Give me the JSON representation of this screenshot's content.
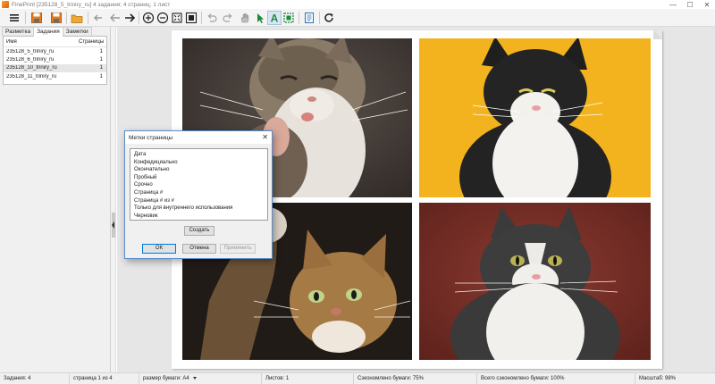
{
  "window": {
    "title": "FinePrint [235128_5_triniry_ru] 4 задания; 4 страниц; 1 лист",
    "minimize": "—",
    "maximize": "☐",
    "close": "✕"
  },
  "toolbar": {
    "buttons": [
      {
        "name": "menu-icon"
      },
      {
        "name": "save-icon"
      },
      {
        "name": "open-folder-icon"
      },
      {
        "name": "back-arrow-icon"
      },
      {
        "name": "forward-arrow-icon"
      },
      {
        "name": "zoom-in-icon"
      },
      {
        "name": "zoom-out-icon"
      },
      {
        "name": "fit-page-icon"
      },
      {
        "name": "undo-icon"
      },
      {
        "name": "redo-icon"
      },
      {
        "name": "hand-icon"
      },
      {
        "name": "pointer-icon"
      },
      {
        "name": "text-tool-icon"
      },
      {
        "name": "crop-tool-icon"
      },
      {
        "name": "document-icon"
      },
      {
        "name": "refresh-icon"
      }
    ]
  },
  "left_panel": {
    "tabs": [
      "Разметка",
      "Задания",
      "Заметки"
    ],
    "active_tab": "Задания",
    "jobs_table": {
      "columns": [
        "Имя",
        "Страницы"
      ],
      "rows": [
        {
          "name": "235128_5_triniry_ru",
          "pages": "1"
        },
        {
          "name": "235128_6_triniry_ru",
          "pages": "1"
        },
        {
          "name": "235128_10_triniry_ru",
          "pages": "1"
        },
        {
          "name": "235128_11_triniry_ru",
          "pages": "1"
        }
      ],
      "highlighted_row": 2
    }
  },
  "page_preview": {
    "photos": [
      "cat-photo-tabby-grey-background",
      "cat-photo-tuxedo-yellow-background",
      "cat-photo-tabby-paw-dark-background",
      "cat-photo-fluffy-tuxedo-red-background"
    ],
    "colors": {
      "tabby_bg": "#3a3330",
      "yellow_bg": "#f2b31e",
      "dark_bg": "#211b17",
      "red_bg": "#7a2c25"
    }
  },
  "dialog": {
    "title": "Метки страницы",
    "close": "✕",
    "items": [
      "Дата",
      "Конфедициально",
      "Окончательно",
      "Пробный",
      "Срочно",
      "Страница #",
      "Страница # из #",
      "Только для внутреннего использования",
      "Черновик"
    ],
    "create_label": "Создать",
    "ok_label": "ОК",
    "cancel_label": "Отмена",
    "apply_label": "Применить"
  },
  "status_bar": {
    "jobs": "Задания: 4",
    "page": "страница 1 из 4",
    "paper_size": "размер бумаги: A4",
    "sheets": "Листов: 1",
    "saved": "Сэкономлено бумаги: 75%",
    "total_saved": "Всего сэкономлено бумаги: 100%",
    "zoom": "Масштаб: 98%"
  }
}
